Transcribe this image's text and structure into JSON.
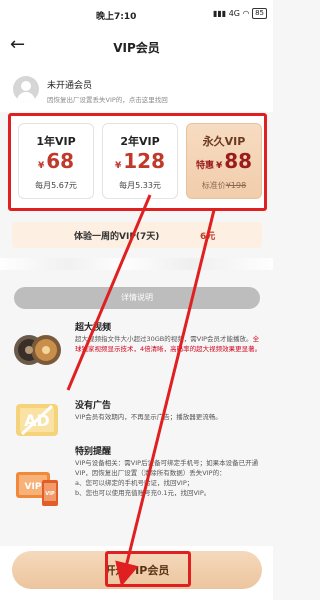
{
  "status_bar": {
    "time": "晚上7:10",
    "network": "4G",
    "battery": "85"
  },
  "nav": {
    "title": "VIP会员"
  },
  "user": {
    "status": "未开通会员",
    "note": "因恢复出厂设置丢失VIP的，点击这里找回"
  },
  "plans": [
    {
      "name": "1年VIP",
      "currency": "¥",
      "price": "68",
      "sub": "每月5.67元"
    },
    {
      "name": "2年VIP",
      "currency": "¥",
      "price": "128",
      "sub": "每月5.33元"
    },
    {
      "name": "永久VIP",
      "tag": "特惠",
      "currency": "¥",
      "price": "88",
      "sub_prefix": "标准价",
      "sub_old": "¥198"
    }
  ],
  "trial": {
    "label": "体验一周的VIP(7天)",
    "price": "6元"
  },
  "detail_button": "详情说明",
  "features": [
    {
      "title": "超大视频",
      "desc_before": "超大视频指文件大小超过30GB的视频，需VIP会员才能播放。",
      "desc_red": "全球独家视频显示技术，4倍清晰，高码率的超大视频效果更显著。",
      "icon": "film-reel-icon"
    },
    {
      "title": "没有广告",
      "desc_before": "VIP会员有效期内，不再显示广告；播放器更流畅。",
      "icon": "ad-block-icon"
    },
    {
      "title": "特别提醒",
      "desc_before": "VIP与设备相关：需VIP后设备可绑定手机号；如果本设备已开通VIP，因恢复出厂设置（清除所有数据）丢失VIP的：",
      "line_a": "a、您可以绑定的手机号验证，找回VIP；",
      "line_b": "b、您也可以使用充值账号充0.1元，找回VIP。",
      "icon": "vip-devices-icon"
    }
  ],
  "open_button": "开通VIP会员",
  "colors": {
    "accent_red": "#e02020",
    "price_red": "#c0392b",
    "gold": "#f1cdab"
  }
}
